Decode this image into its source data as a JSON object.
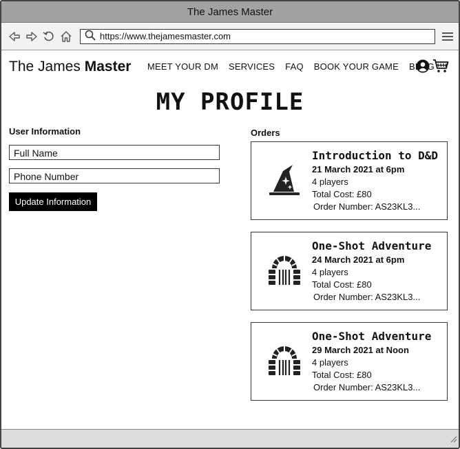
{
  "window": {
    "title": "The James Master"
  },
  "browser": {
    "url": "https://www.thejamesmaster.com"
  },
  "site": {
    "logo_light": "The James ",
    "logo_bold": "Master",
    "nav": [
      "MEET YOUR DM",
      "SERVICES",
      "FAQ",
      "BOOK YOUR GAME",
      "BLOG"
    ]
  },
  "page": {
    "title": "MY PROFILE"
  },
  "user_info": {
    "label": "User Information",
    "full_name_placeholder": "Full Name",
    "phone_placeholder": "Phone Number",
    "update_button": "Update Information"
  },
  "orders": {
    "label": "Orders",
    "items": [
      {
        "icon": "wizard-hat-icon",
        "title": "Introduction to D&D",
        "date": "21 March 2021 at 6pm",
        "players": "4 players",
        "cost": "Total Cost: £80",
        "order_number": "Order Number: AS23KL3..."
      },
      {
        "icon": "dungeon-door-icon",
        "title": "One-Shot Adventure",
        "date": "24 March 2021 at 6pm",
        "players": "4 players",
        "cost": "Total Cost: £80",
        "order_number": "Order Number: AS23KL3..."
      },
      {
        "icon": "dungeon-door-icon",
        "title": "One-Shot Adventure",
        "date": "29 March 2021 at Noon",
        "players": "4 players",
        "cost": "Total Cost: £80",
        "order_number": "Order Number: AS23KL3..."
      }
    ]
  }
}
